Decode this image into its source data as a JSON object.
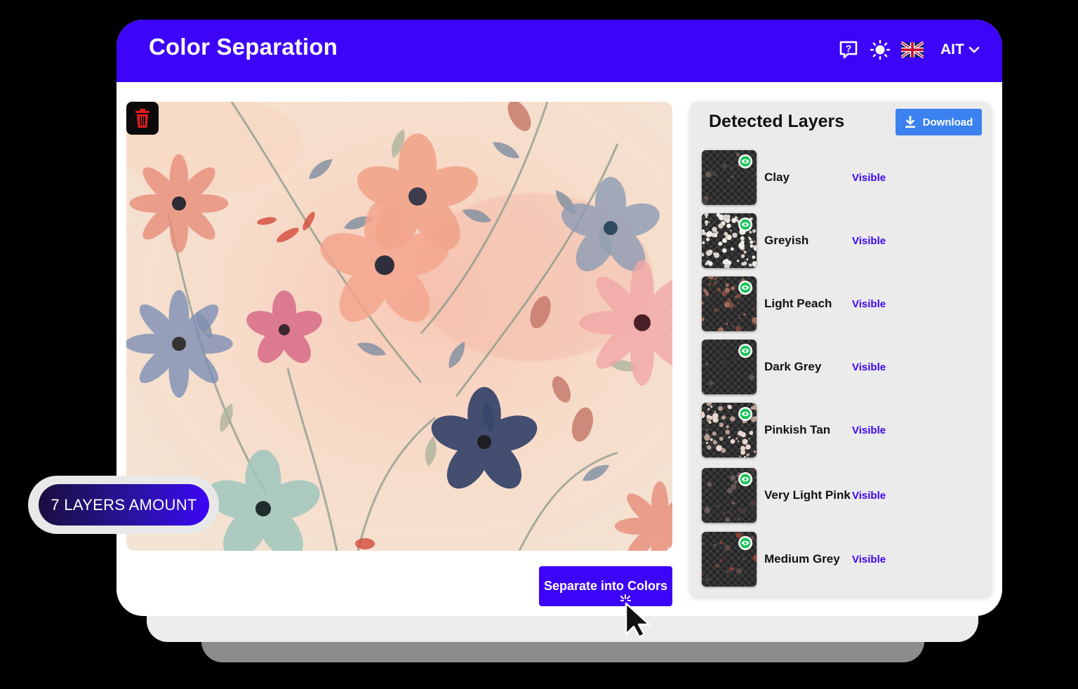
{
  "app": {
    "title": "Color Separation"
  },
  "header": {
    "help_icon": "help-chat-icon",
    "theme_icon": "sun-icon",
    "flag_icon": "uk-flag-icon",
    "language": "AIT"
  },
  "canvas": {
    "delete_icon": "trash-icon"
  },
  "actions": {
    "separate_label": "Separate into Colors"
  },
  "badge": {
    "label": "7 LAYERS AMOUNT"
  },
  "layers_panel": {
    "title": "Detected Layers",
    "download_label": "Download",
    "layers": [
      {
        "name": "Clay",
        "status": "Visible"
      },
      {
        "name": "Greyish",
        "status": "Visible"
      },
      {
        "name": "Light Peach",
        "status": "Visible"
      },
      {
        "name": "Dark Grey",
        "status": "Visible"
      },
      {
        "name": "Pinkish Tan",
        "status": "Visible"
      },
      {
        "name": "Very Light Pink",
        "status": "Visible"
      },
      {
        "name": "Medium Grey",
        "status": "Visible"
      }
    ]
  },
  "colors": {
    "brand": "#3c05f7",
    "download": "#3b82f0",
    "eye": "#22c55e"
  }
}
